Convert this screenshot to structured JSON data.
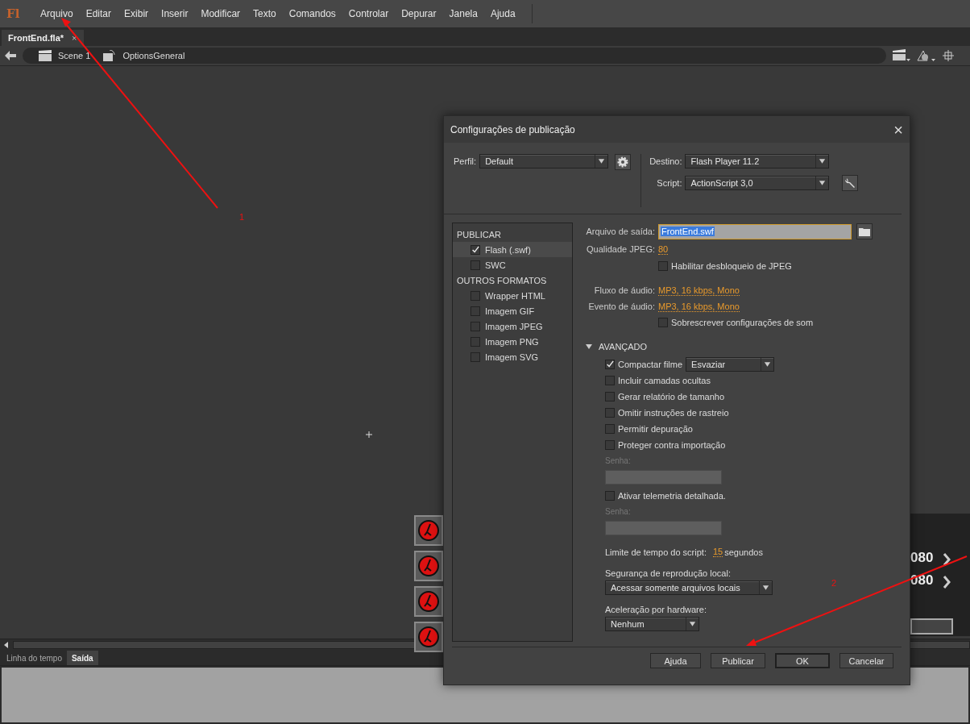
{
  "app_logo": "Fl",
  "menu": [
    "Arquivo",
    "Editar",
    "Exibir",
    "Inserir",
    "Modificar",
    "Texto",
    "Comandos",
    "Controlar",
    "Depurar",
    "Janela",
    "Ajuda"
  ],
  "document_tab": {
    "label": "FrontEnd.fla*",
    "close": "×"
  },
  "breadcrumb": [
    "Scene 1",
    "OptionsGeneral"
  ],
  "stage_fragments": [
    "080",
    "080"
  ],
  "panel_tabs": [
    {
      "label": "Linha do tempo",
      "selected": false
    },
    {
      "label": "Saída",
      "selected": true
    }
  ],
  "dialog": {
    "title": "Configurações de publicação",
    "close": "×",
    "profile": {
      "label": "Perfil:",
      "value": "Default"
    },
    "target": {
      "label": "Destino:",
      "value": "Flash Player 11.2"
    },
    "script": {
      "label": "Script:",
      "value": "ActionScript 3,0"
    },
    "formats": [
      {
        "kind": "header",
        "label": "PUBLICAR"
      },
      {
        "kind": "option",
        "label": "Flash (.swf)",
        "checked": true,
        "selected": true
      },
      {
        "kind": "option",
        "label": "SWC",
        "checked": false,
        "selected": false
      },
      {
        "kind": "header",
        "label": "OUTROS FORMATOS"
      },
      {
        "kind": "option",
        "label": "Wrapper HTML",
        "checked": false,
        "selected": false
      },
      {
        "kind": "option",
        "label": "Imagem GIF",
        "checked": false,
        "selected": false
      },
      {
        "kind": "option",
        "label": "Imagem JPEG",
        "checked": false,
        "selected": false
      },
      {
        "kind": "option",
        "label": "Imagem PNG",
        "checked": false,
        "selected": false
      },
      {
        "kind": "option",
        "label": "Imagem SVG",
        "checked": false,
        "selected": false
      }
    ],
    "output_file": {
      "label": "Arquivo de saída:",
      "value": "FrontEnd.swf"
    },
    "jpeg_quality": {
      "label": "Qualidade JPEG:",
      "value": "80"
    },
    "jpeg_deblocking": {
      "label": "Habilitar desbloqueio de JPEG",
      "checked": false
    },
    "audio_stream": {
      "label": "Fluxo de áudio:",
      "value": "MP3, 16 kbps, Mono"
    },
    "audio_event": {
      "label": "Evento de áudio:",
      "value": "MP3, 16 kbps, Mono"
    },
    "override_sound": {
      "label": "Sobrescrever configurações de som",
      "checked": false
    },
    "advanced": {
      "label": "AVANÇADO",
      "expanded": true
    },
    "advanced_items": [
      {
        "kind": "check_select",
        "label": "Compactar filme",
        "checked": true,
        "value": "Esvaziar"
      },
      {
        "kind": "check",
        "label": "Incluir camadas ocultas",
        "checked": false
      },
      {
        "kind": "check",
        "label": "Gerar relatório de tamanho",
        "checked": false
      },
      {
        "kind": "check",
        "label": "Omitir instruções de rastreio",
        "checked": false
      },
      {
        "kind": "check",
        "label": "Permitir depuração",
        "checked": false
      },
      {
        "kind": "check",
        "label": "Proteger contra importação",
        "checked": false
      },
      {
        "kind": "password",
        "label": "Senha:",
        "disabled": true
      },
      {
        "kind": "check",
        "label": "Ativar telemetria detalhada.",
        "checked": false
      },
      {
        "kind": "password",
        "label": "Senha:",
        "disabled": true
      }
    ],
    "script_time_limit": {
      "label": "Limite de tempo do script:",
      "value": "15",
      "unit": "segundos"
    },
    "local_playback": {
      "label": "Segurança de reprodução local:",
      "value": "Acessar somente arquivos locais"
    },
    "hardware": {
      "label": "Aceleração por hardware:",
      "value": "Nenhum"
    },
    "buttons": [
      {
        "label": "Ajuda",
        "default": false
      },
      {
        "label": "Publicar",
        "default": false
      },
      {
        "label": "OK",
        "default": true
      },
      {
        "label": "Cancelar",
        "default": false
      }
    ]
  },
  "annotations": [
    {
      "label": "1"
    },
    {
      "label": "2"
    }
  ]
}
